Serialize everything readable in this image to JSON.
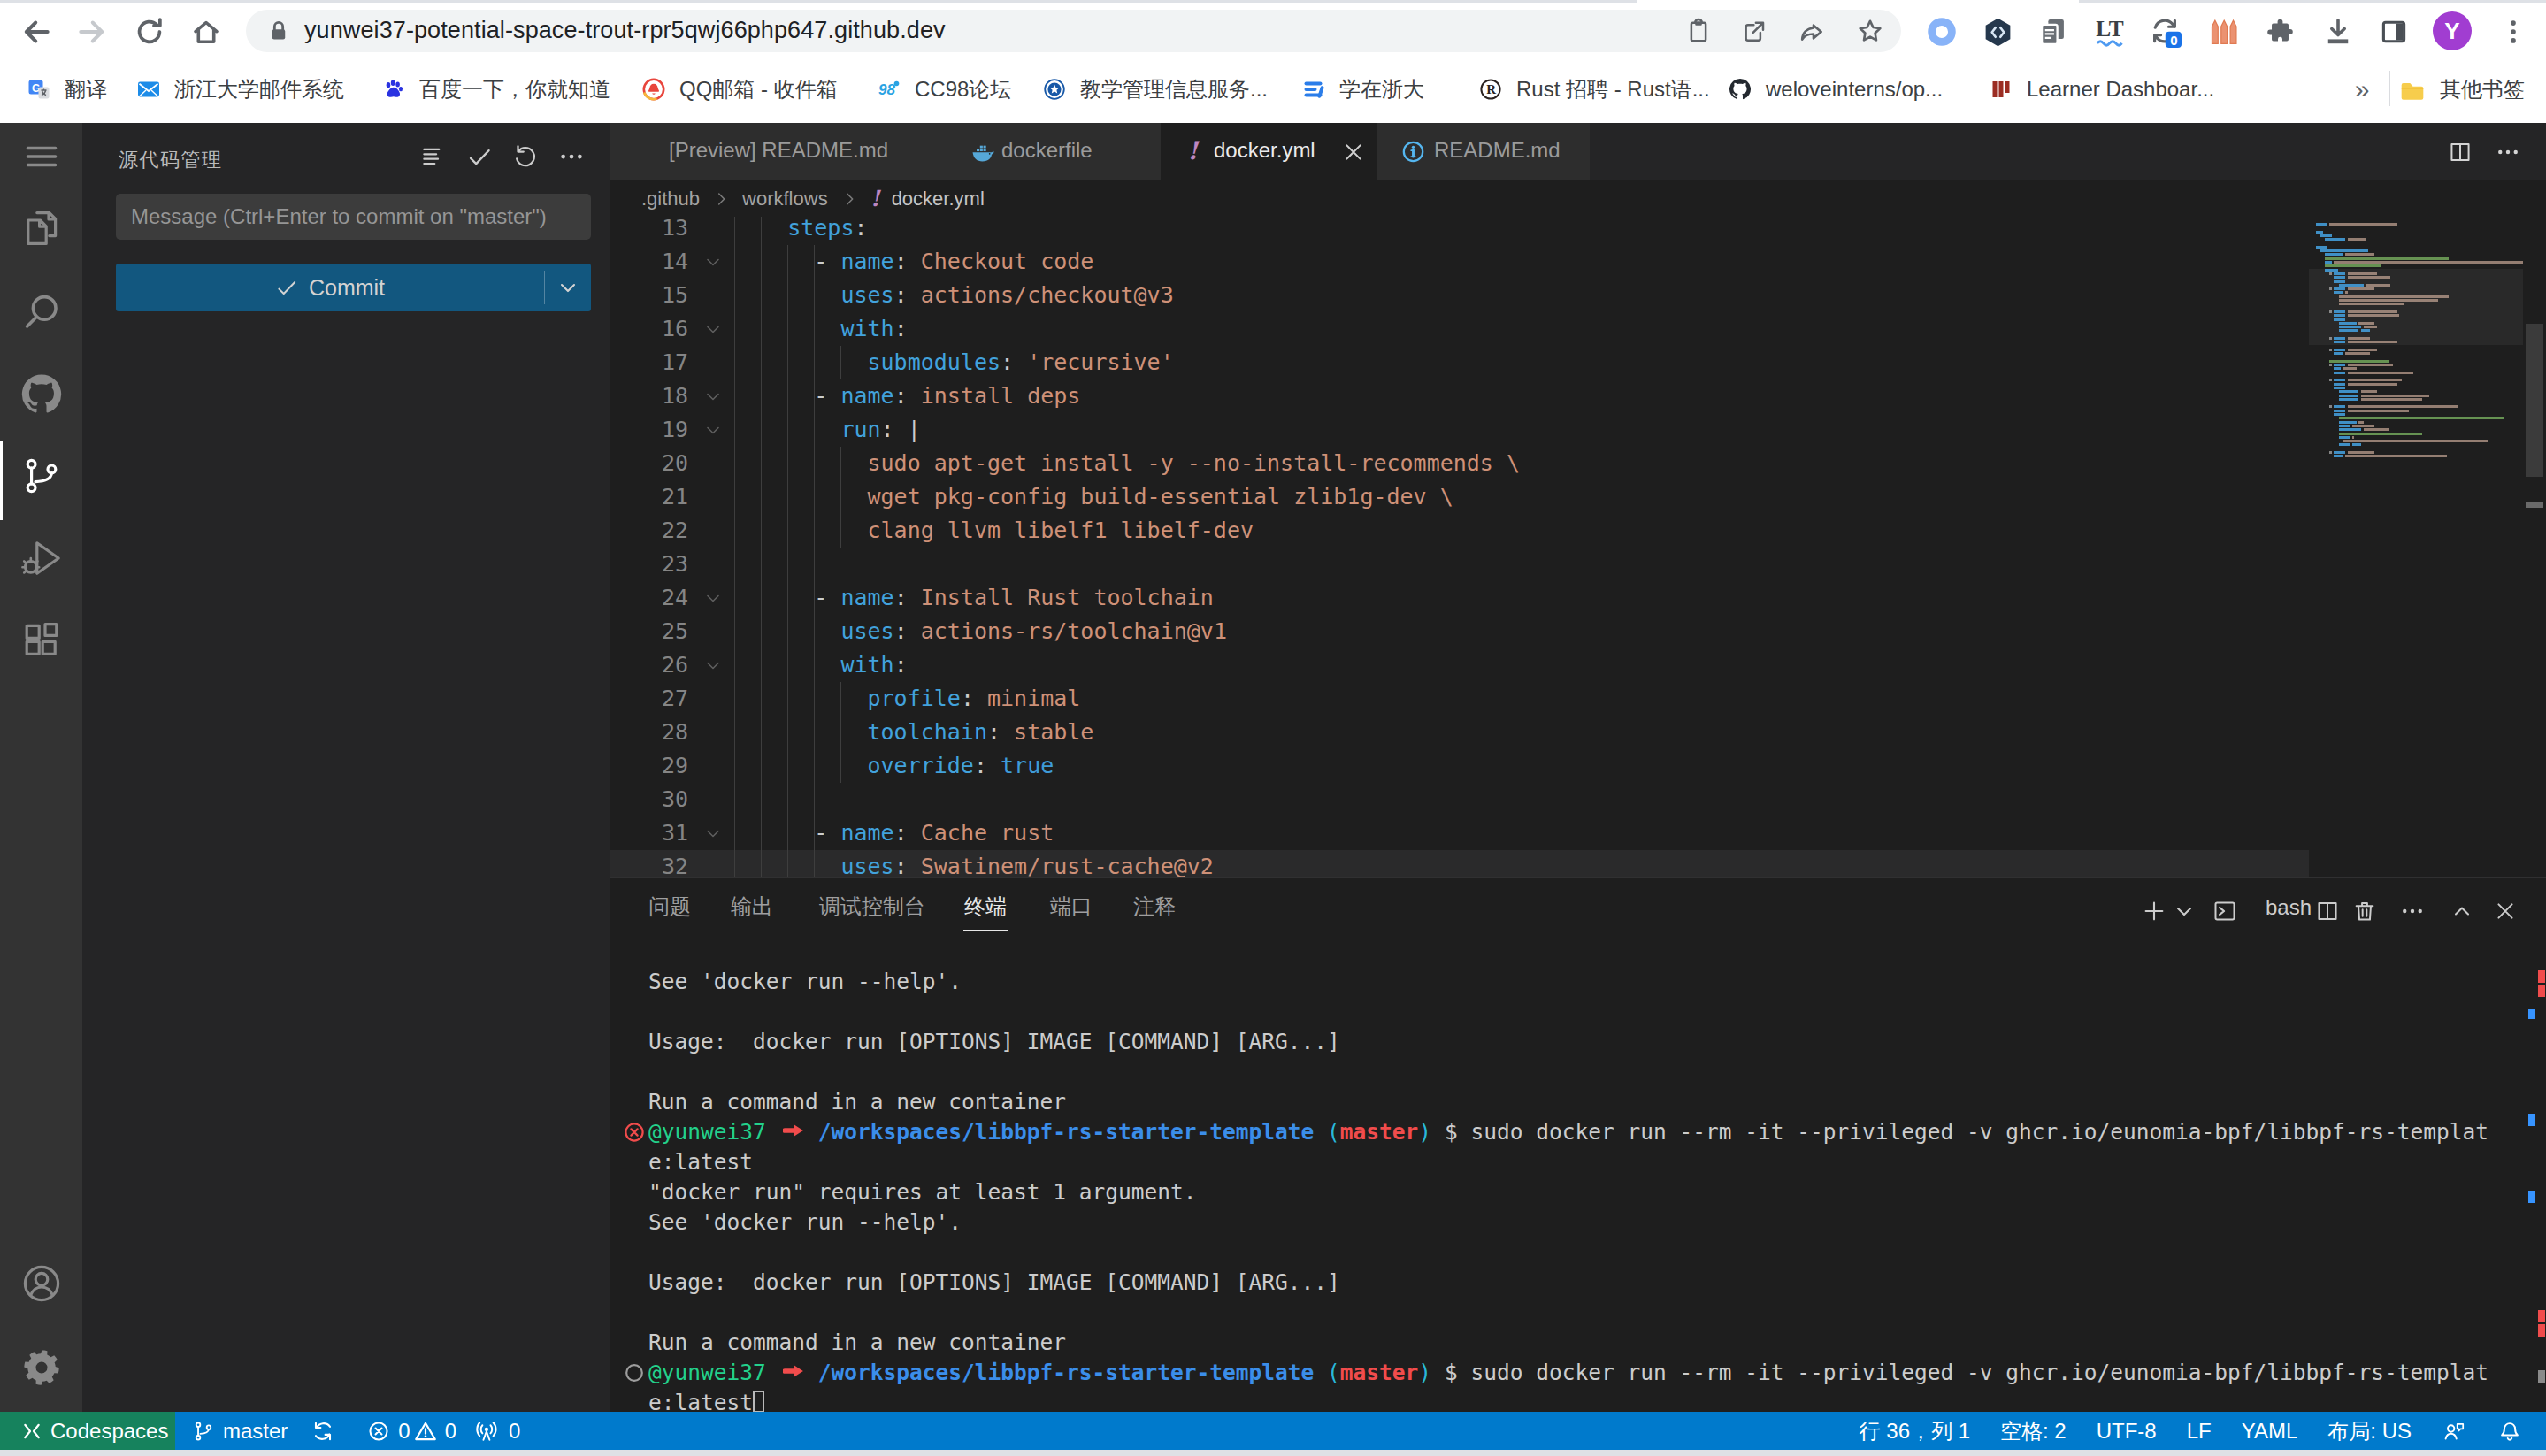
{
  "browser": {
    "url": "yunwei37-potential-space-trout-rpr5qwj66php647.github.dev",
    "toolbar_icons": [
      "back-icon",
      "forward-icon",
      "reload-icon",
      "home-icon"
    ],
    "omnibox_icons": [
      "lock-icon",
      "clipboard-icon",
      "open-in-new-icon",
      "share-icon",
      "bookmark-star-icon"
    ],
    "extension_icons": [
      "blue-ring-icon",
      "dev-shield-icon",
      "copy-pages-icon",
      "languagetool-icon",
      "sync-badge-icon",
      "orange-bars-icon",
      "puzzle-icon",
      "download-icon",
      "reading-mode-icon"
    ],
    "sync_badge_count": "0",
    "avatar_initial": "Y",
    "bookmarks": [
      {
        "label": "翻译",
        "icon": "google-translate"
      },
      {
        "label": "浙江大学邮件系统",
        "icon": "mail"
      },
      {
        "label": "百度一下，你就知道",
        "icon": "baidu"
      },
      {
        "label": "QQ邮箱 - 收件箱",
        "icon": "qqmail"
      },
      {
        "label": "CC98论坛",
        "icon": "cc98"
      },
      {
        "label": "教学管理信息服务...",
        "icon": "zju"
      },
      {
        "label": "学在浙大",
        "icon": "xzzd"
      },
      {
        "label": "Rust 招聘 - Rust语...",
        "icon": "rust"
      },
      {
        "label": "weloveinterns/op...",
        "icon": "github"
      },
      {
        "label": "Learner Dashboar...",
        "icon": "lil"
      }
    ],
    "overflow_chevron": "»",
    "other_bookmarks_label": "其他书签"
  },
  "activity_bar": {
    "items": [
      "menu",
      "explorer",
      "search",
      "github",
      "source-control",
      "debug",
      "extensions"
    ],
    "active_item": "source-control",
    "bottom_items": [
      "account",
      "settings-gear"
    ]
  },
  "sidebar": {
    "title": "源代码管理",
    "actions": [
      "view-as-list",
      "check-all",
      "refresh",
      "more"
    ],
    "message_placeholder": "Message (Ctrl+Enter to commit on \"master\")",
    "commit_label": "Commit"
  },
  "editor": {
    "tabs": [
      {
        "label": "[Preview] README.md",
        "icon": null,
        "active": false,
        "close": false
      },
      {
        "label": "dockerfile",
        "icon": "docker",
        "active": false,
        "close": false
      },
      {
        "label": "docker.yml",
        "icon": "yaml-bang",
        "active": true,
        "close": true
      },
      {
        "label": "README.md",
        "icon": "info",
        "active": false,
        "close": false
      }
    ],
    "breadcrumbs": [
      ".github",
      "workflows",
      "docker.yml"
    ],
    "breadcrumb_file_icon": "yaml-bang",
    "fold_lines": [
      14,
      16,
      18,
      19,
      24,
      26,
      31
    ],
    "highlight_line": 32,
    "lines": [
      {
        "n": 13,
        "tokens": [
          [
            "pl",
            "    "
          ],
          [
            "key",
            "steps"
          ],
          [
            "pn",
            ":"
          ]
        ]
      },
      {
        "n": 14,
        "tokens": [
          [
            "pl",
            "      - "
          ],
          [
            "key",
            "name"
          ],
          [
            "pn",
            ": "
          ],
          [
            "val",
            "Checkout code"
          ]
        ]
      },
      {
        "n": 15,
        "tokens": [
          [
            "pl",
            "        "
          ],
          [
            "key",
            "uses"
          ],
          [
            "pn",
            ": "
          ],
          [
            "val",
            "actions/checkout@v3"
          ]
        ]
      },
      {
        "n": 16,
        "tokens": [
          [
            "pl",
            "        "
          ],
          [
            "key",
            "with"
          ],
          [
            "pn",
            ":"
          ]
        ]
      },
      {
        "n": 17,
        "tokens": [
          [
            "pl",
            "          "
          ],
          [
            "key",
            "submodules"
          ],
          [
            "pn",
            ": "
          ],
          [
            "val",
            "'recursive'"
          ]
        ]
      },
      {
        "n": 18,
        "tokens": [
          [
            "pl",
            "      - "
          ],
          [
            "key",
            "name"
          ],
          [
            "pn",
            ": "
          ],
          [
            "val",
            "install deps"
          ]
        ]
      },
      {
        "n": 19,
        "tokens": [
          [
            "pl",
            "        "
          ],
          [
            "key",
            "run"
          ],
          [
            "pn",
            ": |"
          ]
        ]
      },
      {
        "n": 20,
        "tokens": [
          [
            "pl",
            "          "
          ],
          [
            "val",
            "sudo apt-get install -y --no-install-recommends \\"
          ]
        ]
      },
      {
        "n": 21,
        "tokens": [
          [
            "pl",
            "          "
          ],
          [
            "val",
            "wget pkg-config build-essential zlib1g-dev \\"
          ]
        ]
      },
      {
        "n": 22,
        "tokens": [
          [
            "pl",
            "          "
          ],
          [
            "val",
            "clang llvm libelf1 libelf-dev"
          ]
        ]
      },
      {
        "n": 23,
        "tokens": []
      },
      {
        "n": 24,
        "tokens": [
          [
            "pl",
            "      - "
          ],
          [
            "key",
            "name"
          ],
          [
            "pn",
            ": "
          ],
          [
            "val",
            "Install Rust toolchain"
          ]
        ]
      },
      {
        "n": 25,
        "tokens": [
          [
            "pl",
            "        "
          ],
          [
            "key",
            "uses"
          ],
          [
            "pn",
            ": "
          ],
          [
            "val",
            "actions-rs/toolchain@v1"
          ]
        ]
      },
      {
        "n": 26,
        "tokens": [
          [
            "pl",
            "        "
          ],
          [
            "key",
            "with"
          ],
          [
            "pn",
            ":"
          ]
        ]
      },
      {
        "n": 27,
        "tokens": [
          [
            "pl",
            "          "
          ],
          [
            "key",
            "profile"
          ],
          [
            "pn",
            ": "
          ],
          [
            "val",
            "minimal"
          ]
        ]
      },
      {
        "n": 28,
        "tokens": [
          [
            "pl",
            "          "
          ],
          [
            "key",
            "toolchain"
          ],
          [
            "pn",
            ": "
          ],
          [
            "val",
            "stable"
          ]
        ]
      },
      {
        "n": 29,
        "tokens": [
          [
            "pl",
            "          "
          ],
          [
            "key",
            "override"
          ],
          [
            "pn",
            ": "
          ],
          [
            "bool",
            "true"
          ]
        ]
      },
      {
        "n": 30,
        "tokens": []
      },
      {
        "n": 31,
        "tokens": [
          [
            "pl",
            "      - "
          ],
          [
            "key",
            "name"
          ],
          [
            "pn",
            ": "
          ],
          [
            "val",
            "Cache rust"
          ]
        ]
      },
      {
        "n": 32,
        "tokens": [
          [
            "pl",
            "        "
          ],
          [
            "key",
            "uses"
          ],
          [
            "pn",
            ": "
          ],
          [
            "val",
            "Swatinem/rust-cache@v2"
          ]
        ]
      }
    ],
    "minimap_file_lines": [
      "name: Build and publish docker image",
      "",
      "on:",
      "  push:",
      "    branches: \"master\"",
      "",
      "jobs:",
      "  build-and-push-image:",
      "    runs-on: ubuntu-latest",
      "    # run only when code is compiling and tests are passing",
      "    if: \"!contains(github.event.head_commit.message, '[skip ci]') && !contains(github.event.head_commit.message, '[skip docker]')\"",
      "    # steps to perform in job",
      "    steps:",
      "      - name: Checkout code",
      "        uses: actions/checkout@v3",
      "        with:",
      "          submodules: 'recursive'",
      "      - name: install deps",
      "        run: |",
      "          sudo apt-get install -y --no-install-recommends \\",
      "          wget pkg-config build-essential zlib1g-dev \\",
      "          clang llvm libelf1 libelf-dev",
      "",
      "      - name: Install Rust toolchain",
      "        uses: actions-rs/toolchain@v1",
      "        with:",
      "          profile: minimal",
      "          toolchain: stable",
      "          override: true",
      "",
      "      - name: Cache rust",
      "        uses: Swatinem/rust-cache@v2",
      "",
      "      - name: build package",
      "        run:  make build",
      "",
      "      # setup Docker buld action",
      "      - name: Set up Docker Buildx",
      "        id: buildx",
      "        uses: docker/setup-buildx-action@v2",
      "",
      "      - name: Login to GitHub Packages",
      "        uses: docker/login-action@v2",
      "        with:",
      "          registry: ghcr.io",
      "          username: ${{ github.repository_owner }}",
      "          password: ${{ secrets.GITHUB_TOKEN }}",
      "",
      "      - name: Build image and push to GitHub Container Registry",
      "        uses: docker/build-push-action@v2",
      "        with:",
      "          # relative path to the place where source code with Dockerfile is located",
      "          context: ./",
      "          file: dockerfile",
      "          platforms: linux/amd64",
      "          # Note: tags has to be all lower-case",
      "          tags: |",
      "            ghcr.io/${{ github.repository_owner }}/libbpf-rs-template:latest",
      "          push: true",
      "",
      "      - name: Image digest",
      "        run: echo ${{ steps.docker_build.outputs.digest }}"
    ]
  },
  "panel": {
    "tabs": [
      "问题",
      "输出",
      "调试控制台",
      "终端",
      "端口",
      "注释"
    ],
    "active_tab": "终端",
    "shell_label": "bash",
    "actions": [
      "new-terminal-plus",
      "chevron-down",
      "terminal-box",
      "split-pane",
      "trash",
      "ellipsis",
      "chevron-up",
      "close"
    ],
    "terminal_lines": [
      {
        "segs": [
          [
            "w",
            "See 'docker run --help'."
          ]
        ]
      },
      {
        "segs": []
      },
      {
        "segs": [
          [
            "w",
            "Usage:  docker run [OPTIONS] IMAGE [COMMAND] [ARG...]"
          ]
        ]
      },
      {
        "segs": []
      },
      {
        "segs": [
          [
            "w",
            "Run a command in a new container"
          ]
        ]
      },
      {
        "deco": "error",
        "segs": [
          [
            "g",
            "@yunwei37"
          ],
          [
            "w",
            " "
          ],
          [
            "arrow",
            "➜"
          ],
          [
            "w",
            " "
          ],
          [
            "b",
            "/workspaces/libbpf-rs-starter-template"
          ],
          [
            "w",
            " "
          ],
          [
            "c",
            "("
          ],
          [
            "r",
            "master"
          ],
          [
            "c",
            ")"
          ],
          [
            "w",
            " $ sudo docker run --rm -it --privileged -v ghcr.io/eunomia-bpf/libbpf-rs-templat"
          ]
        ]
      },
      {
        "segs": [
          [
            "w",
            "e:latest"
          ]
        ]
      },
      {
        "segs": [
          [
            "w",
            "\"docker run\" requires at least 1 argument."
          ]
        ]
      },
      {
        "segs": [
          [
            "w",
            "See 'docker run --help'."
          ]
        ]
      },
      {
        "segs": []
      },
      {
        "segs": [
          [
            "w",
            "Usage:  docker run [OPTIONS] IMAGE [COMMAND] [ARG...]"
          ]
        ]
      },
      {
        "segs": []
      },
      {
        "segs": [
          [
            "w",
            "Run a command in a new container"
          ]
        ]
      },
      {
        "deco": "running",
        "segs": [
          [
            "g",
            "@yunwei37"
          ],
          [
            "w",
            " "
          ],
          [
            "arrow",
            "➜"
          ],
          [
            "w",
            " "
          ],
          [
            "b",
            "/workspaces/libbpf-rs-starter-template"
          ],
          [
            "w",
            " "
          ],
          [
            "c",
            "("
          ],
          [
            "r",
            "master"
          ],
          [
            "c",
            ")"
          ],
          [
            "w",
            " $ sudo docker run --rm -it --privileged -v ghcr.io/eunomia-bpf/libbpf-rs-templat"
          ]
        ]
      },
      {
        "segs": [
          [
            "w",
            "e:latest"
          ]
        ],
        "cursor": true
      }
    ]
  },
  "status_bar": {
    "remote_label": "Codespaces",
    "branch": "master",
    "error_count": "0",
    "warning_count": "0",
    "port_count": "0",
    "cursor_position": "行 36，列 1",
    "indentation": "空格: 2",
    "encoding": "UTF-8",
    "eol": "LF",
    "language": "YAML",
    "keyboard_layout": "布局: US"
  }
}
